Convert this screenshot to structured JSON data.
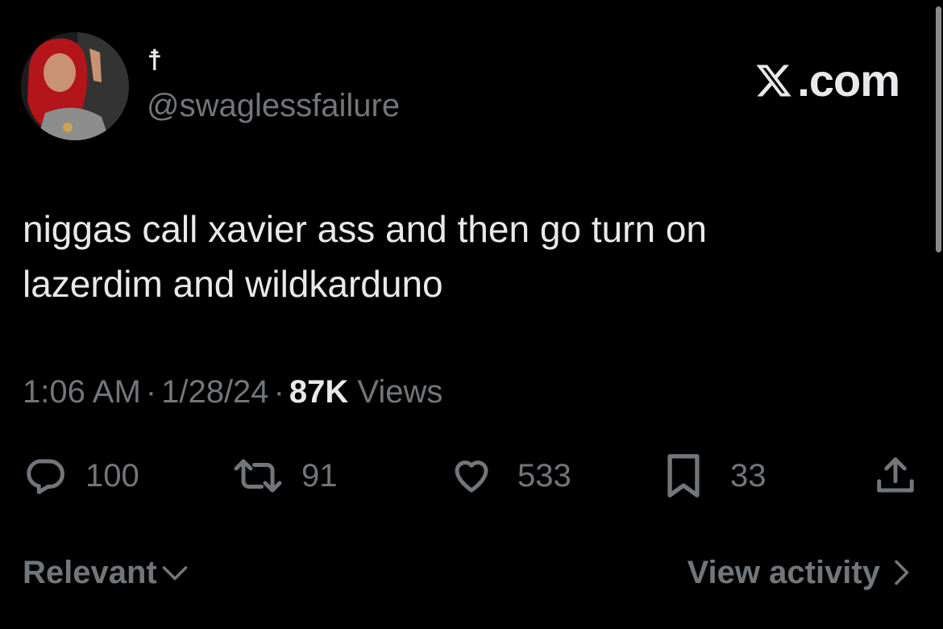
{
  "author": {
    "display_name": "☨",
    "handle": "@swaglessfailure"
  },
  "watermark": {
    "site_text": ".com",
    "logo_icon": "x-logo-icon"
  },
  "tweet": {
    "text_lines": [
      "niggas call xavier ass and then go turn on",
      "lazerdim and wildkarduno"
    ],
    "time": "1:06 AM",
    "date": "1/28/24",
    "separator": "·",
    "views_count": "87K",
    "views_label": "Views"
  },
  "actions": {
    "replies": {
      "count": "100",
      "icon": "reply-icon"
    },
    "reposts": {
      "count": "91",
      "icon": "repost-icon"
    },
    "likes": {
      "count": "533",
      "icon": "heart-icon"
    },
    "bookmarks": {
      "count": "33",
      "icon": "bookmark-icon"
    },
    "share": {
      "icon": "share-icon"
    }
  },
  "footer": {
    "sort_label": "Relevant",
    "activity_label": "View activity"
  },
  "colors": {
    "background": "#000000",
    "primary_text": "#e7e9ea",
    "secondary_text": "#71767b"
  }
}
